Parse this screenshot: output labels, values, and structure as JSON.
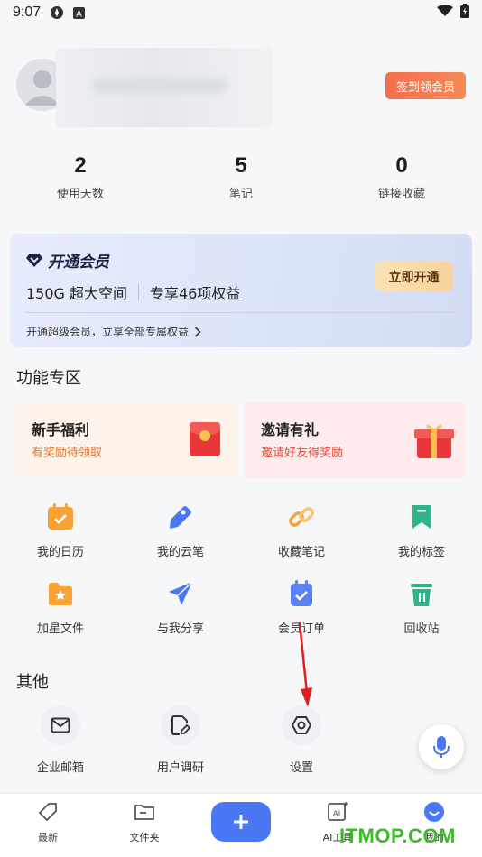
{
  "status_bar": {
    "time": "9:07"
  },
  "profile": {
    "signin_label": "签到领会员"
  },
  "stats": [
    {
      "value": "2",
      "label": "使用天数"
    },
    {
      "value": "5",
      "label": "笔记"
    },
    {
      "value": "0",
      "label": "链接收藏"
    }
  ],
  "vip": {
    "title": "开通会员",
    "space": "150G 超大空间",
    "benefits": "专享46项权益",
    "button": "立即开通",
    "link": "开通超级会员，立享全部专属权益"
  },
  "features": {
    "heading": "功能专区",
    "card1": {
      "title": "新手福利",
      "subtitle": "有奖励待领取"
    },
    "card2": {
      "title": "邀请有礼",
      "subtitle": "邀请好友得奖励"
    },
    "items": [
      "我的日历",
      "我的云笔",
      "收藏笔记",
      "我的标签",
      "加星文件",
      "与我分享",
      "会员订单",
      "回收站"
    ]
  },
  "other": {
    "heading": "其他",
    "items": [
      "企业邮箱",
      "用户调研",
      "设置"
    ]
  },
  "tabbar": {
    "tabs": [
      "最新",
      "文件夹",
      "AI工具",
      "我的"
    ]
  },
  "watermark": "ITMOP.COM",
  "colors": {
    "accent": "#4a78f5",
    "signin": "#f36d4c",
    "vip_button": "#f7d39a"
  }
}
